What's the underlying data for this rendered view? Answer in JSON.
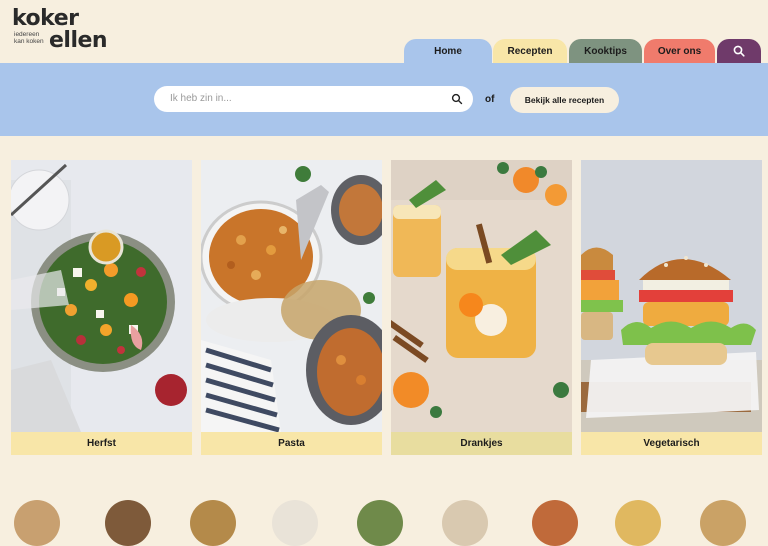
{
  "logo": {
    "line1": "koker",
    "line2": "ellen",
    "tagline1": "iedereen",
    "tagline2": "kan koken"
  },
  "nav": {
    "home": "Home",
    "recepten": "Recepten",
    "kooktips": "Kooktips",
    "over_ons": "Over ons",
    "search_icon": "search-icon"
  },
  "search": {
    "placeholder": "Ik heb zin in...",
    "or": "of",
    "all_recipes": "Bekijk alle recepten"
  },
  "categories": [
    {
      "label": "Herfst"
    },
    {
      "label": "Pasta"
    },
    {
      "label": "Drankjes"
    },
    {
      "label": "Vegetarisch"
    }
  ],
  "colors": {
    "background": "#f7efdf",
    "band": "#a9c5eb",
    "home": "#a9c5eb",
    "recepten": "#f8e6a8",
    "kooktips": "#7e9380",
    "over_ons": "#f07b6c",
    "search": "#6f3a6a"
  }
}
